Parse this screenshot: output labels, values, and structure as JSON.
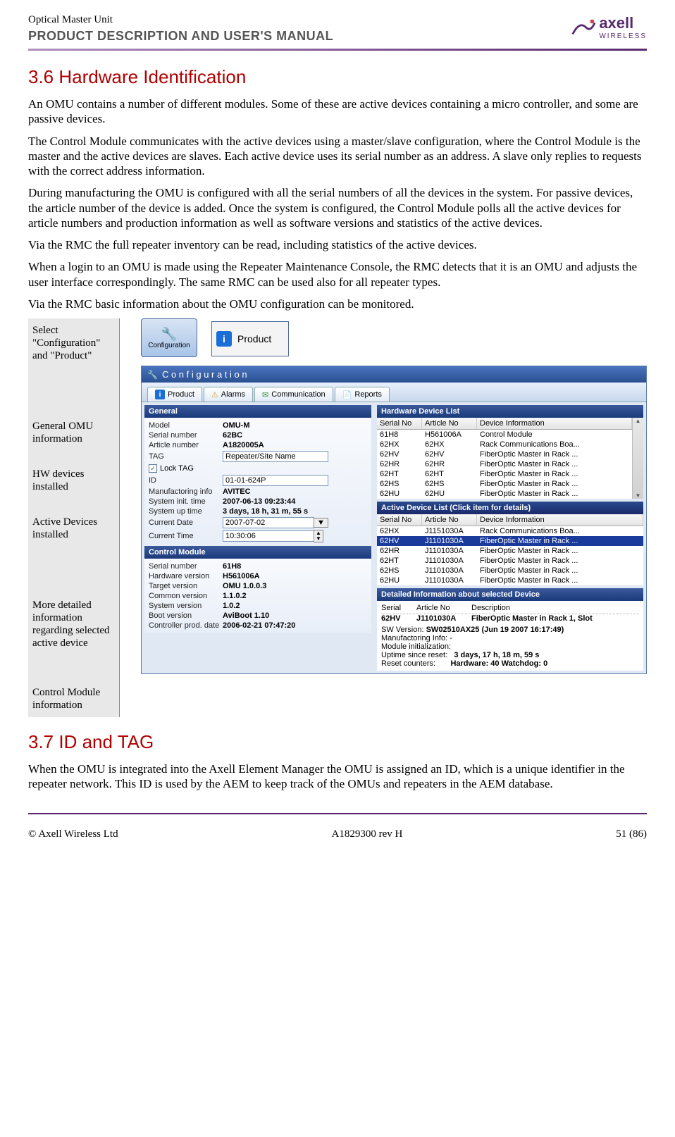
{
  "header": {
    "product": "Optical Master Unit",
    "subtitle": "PRODUCT DESCRIPTION AND USER'S MANUAL",
    "logo_text": "axell",
    "logo_sub": "WIRELESS"
  },
  "section36": {
    "heading": "3.6    Hardware Identification",
    "p1": "An OMU contains a number of different modules. Some of these are active devices containing a micro controller, and some are passive devices.",
    "p2": "The Control Module communicates with the active devices using a master/slave configuration, where the Control Module is the master and the active devices are slaves. Each active device uses its serial number as an address. A slave only replies to requests with the correct address information.",
    "p3": "During manufacturing the OMU is configured with all the serial numbers of all the devices in the system. For passive devices, the article number of the device is added. Once the system is configured, the Control Module polls all the active devices for article numbers and production information as well as software versions and statistics of the active devices.",
    "p4": "Via the RMC the full repeater inventory can be read, including statistics of the active devices.",
    "p5": "When a login to an OMU is made using the Repeater Maintenance Console, the RMC detects that it is an OMU and adjusts the user interface correspondingly. The same RMC can be used also for all repeater types.",
    "p6": "Via the RMC basic information about the OMU configuration can be monitored."
  },
  "callouts": {
    "c1": "Select \"Configuration\" and  \"Product\"",
    "c2": "General OMU information",
    "c3": "HW devices installed",
    "c4": "Active Devices installed",
    "c5": "More detailed information regarding selected active device",
    "c6": "Control Module information"
  },
  "icons": {
    "config_label": "Configuration",
    "product_label": "Product"
  },
  "window": {
    "title": "C o n f i g u r a t i o n",
    "tabs": {
      "product": "Product",
      "alarms": "Alarms",
      "communication": "Communication",
      "reports": "Reports"
    }
  },
  "general": {
    "header": "General",
    "rows": {
      "model_l": "Model",
      "model_v": "OMU-M",
      "serial_l": "Serial number",
      "serial_v": "62BC",
      "article_l": "Article number",
      "article_v": "A1820005A",
      "tag_l": "TAG",
      "tag_v": "Repeater/Site Name",
      "locktag_l": "Lock TAG",
      "id_l": "ID",
      "id_v": "01-01-624P",
      "mfg_l": "Manufactoring info",
      "mfg_v": "AVITEC",
      "init_l": "System init. time",
      "init_v": "2007-06-13    09:23:44",
      "uptime_l": "System up time",
      "uptime_v": "3 days, 18 h, 31 m, 55 s",
      "curdate_l": "Current Date",
      "curdate_v": "2007-07-02",
      "curtime_l": "Current Time",
      "curtime_v": "10:30:06"
    }
  },
  "control_module": {
    "header": "Control Module",
    "rows": {
      "serial_l": "Serial number",
      "serial_v": "61H8",
      "hw_l": "Hardware version",
      "hw_v": "H561006A",
      "target_l": "Target version",
      "target_v": "OMU 1.0.0.3",
      "common_l": "Common version",
      "common_v": "1.1.0.2",
      "system_l": "System version",
      "system_v": "1.0.2",
      "boot_l": "Boot version",
      "boot_v": "AviBoot 1.10",
      "ctrl_l": "Controller prod. date",
      "ctrl_v": "2006-02-21    07:47:20"
    }
  },
  "hardware_list": {
    "header": "Hardware Device List",
    "cols": {
      "c1": "Serial No",
      "c2": "Article No",
      "c3": "Device Information"
    },
    "rows": [
      {
        "c1": "61H8",
        "c2": "H561006A",
        "c3": "Control Module"
      },
      {
        "c1": "62HX",
        "c2": "62HX",
        "c3": "Rack Communications Boa..."
      },
      {
        "c1": "62HV",
        "c2": "62HV",
        "c3": "FiberOptic Master in Rack ..."
      },
      {
        "c1": "62HR",
        "c2": "62HR",
        "c3": "FiberOptic Master in Rack ..."
      },
      {
        "c1": "62HT",
        "c2": "62HT",
        "c3": "FiberOptic Master in Rack ..."
      },
      {
        "c1": "62HS",
        "c2": "62HS",
        "c3": "FiberOptic Master in Rack ..."
      },
      {
        "c1": "62HU",
        "c2": "62HU",
        "c3": "FiberOptic Master in Rack ..."
      }
    ]
  },
  "active_list": {
    "header": "Active Device List  (Click item for details)",
    "cols": {
      "c1": "Serial No",
      "c2": "Article No",
      "c3": "Device Information"
    },
    "rows": [
      {
        "c1": "62HX",
        "c2": "J1151030A",
        "c3": "Rack Communications Boa...",
        "sel": false
      },
      {
        "c1": "62HV",
        "c2": "J1101030A",
        "c3": "FiberOptic Master in Rack ...",
        "sel": true
      },
      {
        "c1": "62HR",
        "c2": "J1101030A",
        "c3": "FiberOptic Master in Rack ...",
        "sel": false
      },
      {
        "c1": "62HT",
        "c2": "J1101030A",
        "c3": "FiberOptic Master in Rack ...",
        "sel": false
      },
      {
        "c1": "62HS",
        "c2": "J1101030A",
        "c3": "FiberOptic Master in Rack ...",
        "sel": false
      },
      {
        "c1": "62HU",
        "c2": "J1101030A",
        "c3": "FiberOptic Master in Rack ...",
        "sel": false
      }
    ]
  },
  "detail": {
    "header": "Detailed Information about selected Device",
    "cols": {
      "c1": "Serial",
      "c2": "Article No",
      "c3": "Description"
    },
    "row": {
      "c1": "62HV",
      "c2": "J1101030A",
      "c3": "FiberOptic Master in Rack 1, Slot"
    },
    "sw_l": "SW Version:",
    "sw_v": "SW02510AX25 (Jun 19 2007  16:17:49)",
    "mfg_l": "Manufactoring Info:",
    "mfg_v": "-",
    "init_l": "Module initialization:",
    "uptime_l": "Uptime since reset:",
    "uptime_v": "3 days, 17 h, 18 m, 59 s",
    "reset_l": "Reset counters:",
    "reset_v": "Hardware: 40  Watchdog: 0"
  },
  "section37": {
    "heading": "3.7    ID and TAG",
    "p1": "When the OMU is integrated into the Axell Element Manager the OMU is assigned an ID, which is a unique identifier in the repeater network. This ID is used by the AEM to keep track of the OMUs and repeaters in the AEM database."
  },
  "footer": {
    "left": "© Axell Wireless Ltd",
    "center": "A1829300 rev H",
    "right": "51 (86)"
  }
}
